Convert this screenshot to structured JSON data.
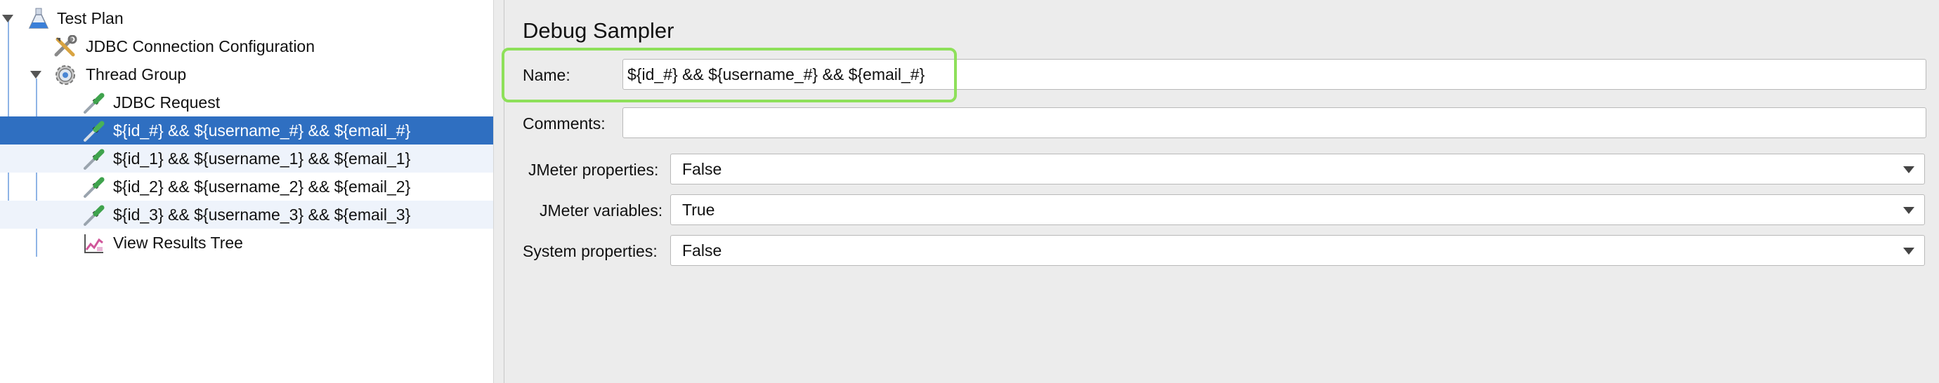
{
  "tree": {
    "items": [
      {
        "label": "Test Plan",
        "icon": "flask-icon"
      },
      {
        "label": "JDBC Connection Configuration",
        "icon": "tools-icon"
      },
      {
        "label": "Thread Group",
        "icon": "gear-icon"
      },
      {
        "label": "JDBC Request",
        "icon": "pipette-icon"
      },
      {
        "label": "${id_#} && ${username_#} && ${email_#}",
        "icon": "pipette-icon"
      },
      {
        "label": "${id_1} && ${username_1} && ${email_1}",
        "icon": "pipette-icon"
      },
      {
        "label": "${id_2} && ${username_2} && ${email_2}",
        "icon": "pipette-icon"
      },
      {
        "label": "${id_3} && ${username_3} && ${email_3}",
        "icon": "pipette-icon"
      },
      {
        "label": "View Results Tree",
        "icon": "results-chart-icon"
      }
    ],
    "selected_index": 4
  },
  "panel": {
    "title": "Debug Sampler",
    "name_label": "Name:",
    "name_value": "${id_#} && ${username_#} && ${email_#}",
    "comments_label": "Comments:",
    "comments_value": "",
    "jmeter_properties_label": "JMeter properties:",
    "jmeter_properties_value": "False",
    "jmeter_variables_label": "JMeter variables:",
    "jmeter_variables_value": "True",
    "system_properties_label": "System properties:",
    "system_properties_value": "False"
  },
  "colors": {
    "selection": "#2f6fc1",
    "highlight": "#8ee05a",
    "alt_row": "#eef3fb"
  }
}
